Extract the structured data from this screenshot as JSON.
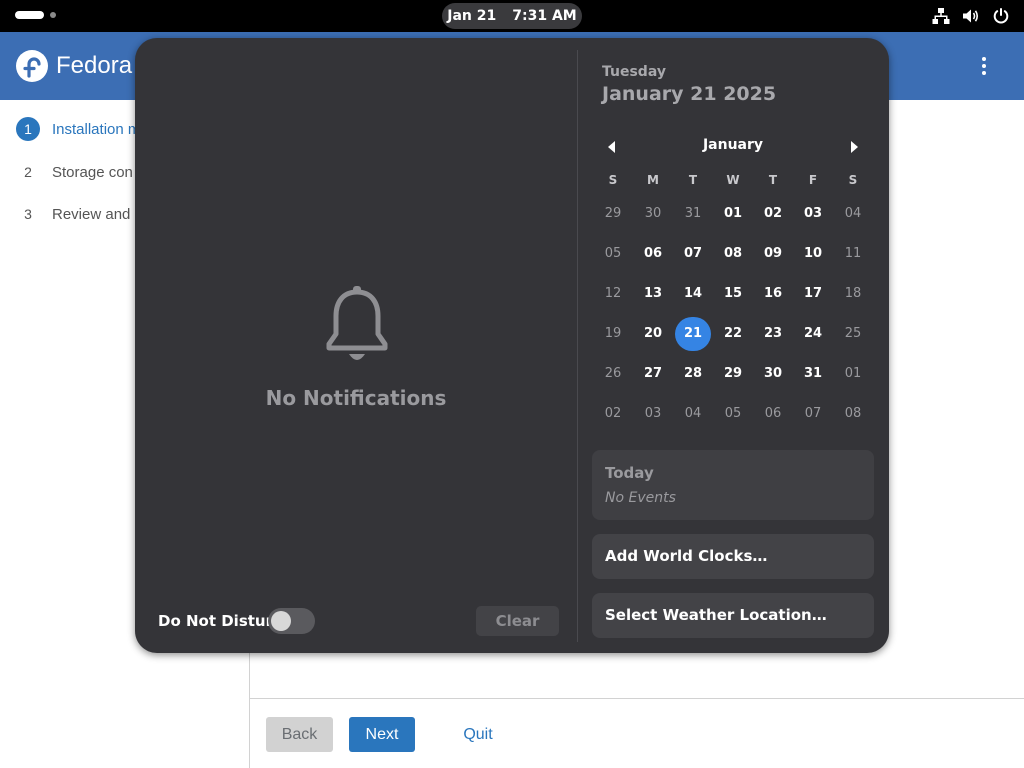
{
  "topbar": {
    "clock_date": "Jan 21",
    "clock_time": "7:31 AM",
    "tray_icons": [
      "network-wired-icon",
      "volume-icon",
      "power-icon"
    ]
  },
  "installer": {
    "app_name": "Fedora",
    "steps": [
      {
        "num": "1",
        "label": "Installation m",
        "current": true
      },
      {
        "num": "2",
        "label": "Storage con",
        "current": false
      },
      {
        "num": "3",
        "label": "Review and",
        "current": false
      }
    ],
    "footer": {
      "back_label": "Back",
      "next_label": "Next",
      "quit_label": "Quit"
    },
    "colors": {
      "header": "#3c6eb4",
      "accent": "#2a76bd"
    }
  },
  "notifications": {
    "empty_label": "No Notifications",
    "dnd_label": "Do Not Disturb",
    "dnd_enabled": false,
    "clear_label": "Clear"
  },
  "calendar": {
    "weekday": "Tuesday",
    "full_date": "January 21 2025",
    "month": "January",
    "dow": [
      "S",
      "M",
      "T",
      "W",
      "T",
      "F",
      "S"
    ],
    "weeks": [
      [
        "29",
        "30",
        "31",
        "01",
        "02",
        "03",
        "04"
      ],
      [
        "05",
        "06",
        "07",
        "08",
        "09",
        "10",
        "11"
      ],
      [
        "12",
        "13",
        "14",
        "15",
        "16",
        "17",
        "18"
      ],
      [
        "19",
        "20",
        "21",
        "22",
        "23",
        "24",
        "25"
      ],
      [
        "26",
        "27",
        "28",
        "29",
        "30",
        "31",
        "01"
      ],
      [
        "02",
        "03",
        "04",
        "05",
        "06",
        "07",
        "08"
      ]
    ],
    "today": "21",
    "events_title": "Today",
    "events_empty": "No Events",
    "world_clocks_label": "Add World Clocks…",
    "weather_label": "Select Weather Location…",
    "colors": {
      "today": "#3584e4"
    }
  }
}
